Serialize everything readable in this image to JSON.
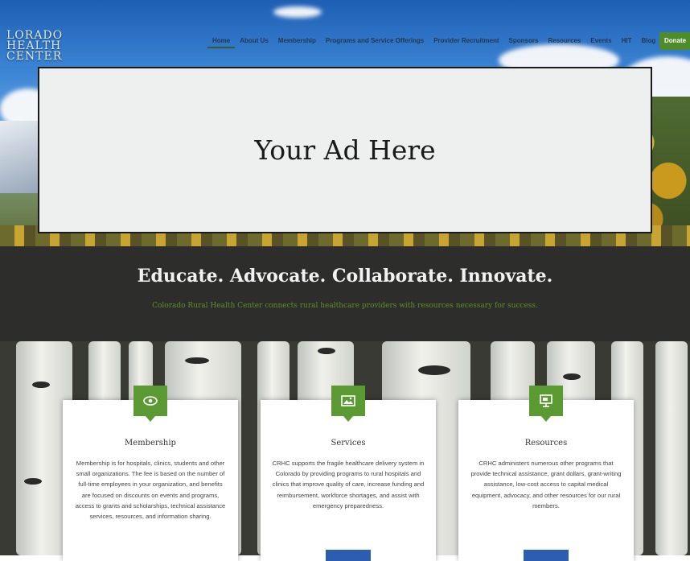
{
  "header": {
    "logo_lines": [
      "LORADO",
      "HEALTH",
      "CENTER"
    ],
    "nav": [
      "Home",
      "About Us",
      "Membership",
      "Programs and Service Offerings",
      "Provider Recruitment",
      "Sponsors",
      "Resources",
      "Events",
      "HIT",
      "Blog"
    ],
    "donate_label": "Donate"
  },
  "ad": {
    "label": "Your Ad Here"
  },
  "tagline": {
    "heading": "Educate. Advocate. Collaborate. Innovate.",
    "subheading": "Colorado Rural Health Center connects rural healthcare providers with resources necessary for success."
  },
  "cards": [
    {
      "icon": "eye-icon",
      "title": "Membership",
      "body": "Membership is for hospitals, clinics, students and other small organizations. The fee is based on the number of full-time employees in your organization, and benefits are focused on discounts on events and programs, access to grants and scholarships, technical assistance services, resources, and information sharing."
    },
    {
      "icon": "image-icon",
      "title": "Services",
      "body": "CRHC supports the fragile healthcare delivery system in Colorado by providing programs to rural hospitals and clinics that improve quality of care, increase funding and reimbursement, workforce shortages, and assist with emergency preparedness."
    },
    {
      "icon": "presentation-icon",
      "title": "Resources",
      "body": "CRHC administers numerous other programs that provide technical assistance, grant dollars, grant-writing assistance, low-cost access to capital medical equipment, advocacy, and other resources for our rural members."
    }
  ],
  "colors": {
    "accent_green": "#5b9a33",
    "band_bg": "#2d2d2b",
    "button_blue": "#2b5db0"
  }
}
